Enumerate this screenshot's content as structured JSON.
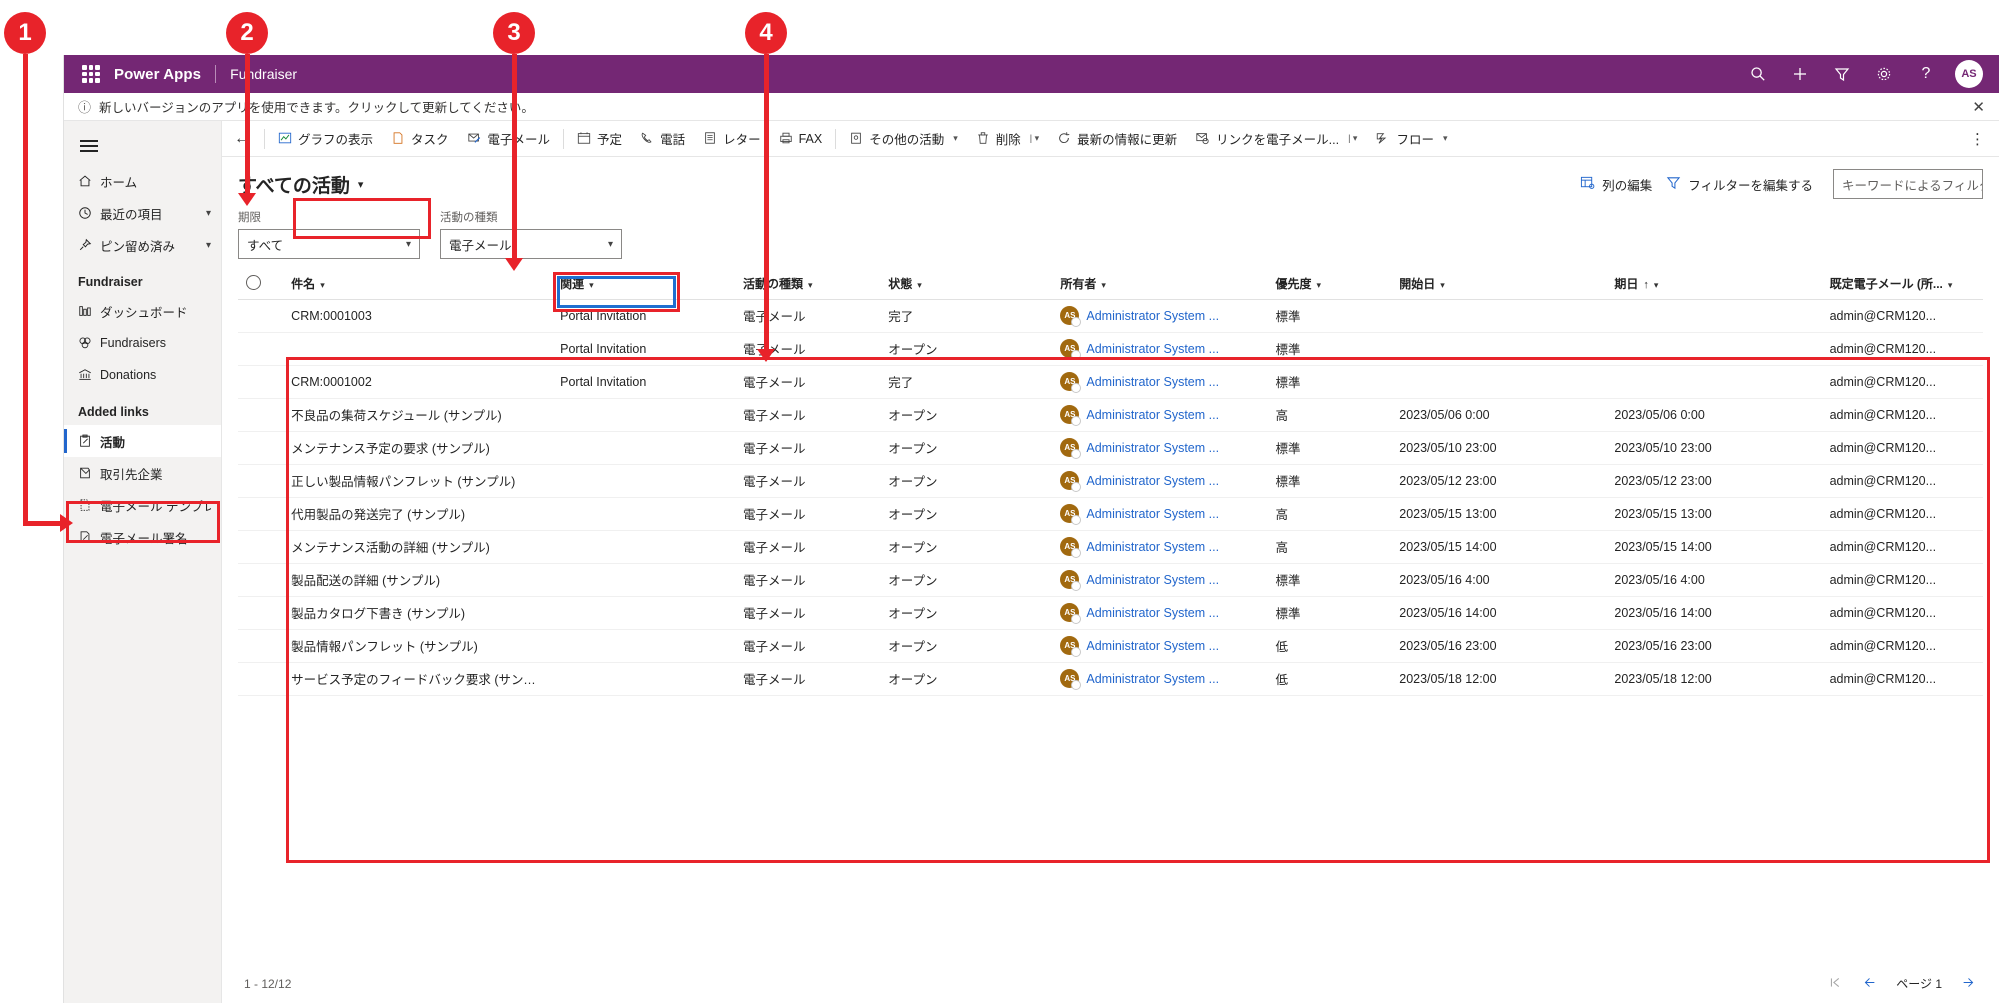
{
  "topbar": {
    "waffle_icon": "waffle-icon",
    "brand": "Power Apps",
    "app_name": "Fundraiser",
    "icons": [
      {
        "name": "search-icon",
        "glyph": "⌕"
      },
      {
        "name": "add-icon",
        "glyph": "＋"
      },
      {
        "name": "filter-icon",
        "glyph": "▽"
      },
      {
        "name": "settings-icon",
        "glyph": "⚙"
      },
      {
        "name": "help-icon",
        "glyph": "?"
      }
    ],
    "avatar_initials": "AS"
  },
  "notice": {
    "icon": "info-icon",
    "text": "新しいバージョンのアプリを使用できます。クリックして更新してください。",
    "close_label": "✕"
  },
  "sidebar": {
    "hamburger_label": "サイト マップの展開/折りたたみ",
    "items": [
      {
        "label": "ホーム",
        "icon": "home-icon",
        "glyph": "⌂",
        "chevron": false,
        "selected": false
      },
      {
        "label": "最近の項目",
        "icon": "clock-icon",
        "glyph": "◴",
        "chevron": true,
        "selected": false
      },
      {
        "label": "ピン留め済み",
        "icon": "pin-icon",
        "glyph": "☆",
        "chevron": true,
        "selected": false
      }
    ],
    "group1_label": "Fundraiser",
    "group1_items": [
      {
        "label": "ダッシュボード",
        "icon": "dashboard-icon",
        "glyph": "▓",
        "selected": false
      },
      {
        "label": "Fundraisers",
        "icon": "fundraisers-icon",
        "glyph": "⍟",
        "selected": false
      },
      {
        "label": "Donations",
        "icon": "donations-icon",
        "glyph": "⛭",
        "selected": false
      }
    ],
    "group2_label": "Added links",
    "group2_items": [
      {
        "label": "活動",
        "icon": "activity-icon",
        "glyph": "✎",
        "selected": true
      },
      {
        "label": "取引先企業",
        "icon": "account-icon",
        "glyph": "⬒",
        "selected": false
      },
      {
        "label": "電子メール テンプレ...",
        "icon": "email-template-icon",
        "glyph": "⬚",
        "selected": false
      },
      {
        "label": "電子メール署名",
        "icon": "email-signature-icon",
        "glyph": "✏",
        "selected": false
      }
    ]
  },
  "commandbar": {
    "back_label": "←",
    "items": [
      {
        "label": "グラフの表示",
        "icon": "chart-icon",
        "glyph": "◰",
        "chevron": false,
        "divider_before": false
      },
      {
        "label": "タスク",
        "icon": "task-icon",
        "glyph": "⬚",
        "chevron": false,
        "divider_before": false
      },
      {
        "label": "電子メール",
        "icon": "email-icon",
        "glyph": "✉",
        "chevron": false,
        "divider_before": false
      },
      {
        "label": "予定",
        "icon": "appointment-icon",
        "glyph": "▦",
        "chevron": false,
        "divider_before": true
      },
      {
        "label": "電話",
        "icon": "phone-icon",
        "glyph": "✆",
        "chevron": false,
        "divider_before": false
      },
      {
        "label": "レター",
        "icon": "letter-icon",
        "glyph": "☰",
        "chevron": false,
        "divider_before": false
      },
      {
        "label": "FAX",
        "icon": "fax-icon",
        "glyph": "⎙",
        "chevron": false,
        "divider_before": false
      },
      {
        "label": "その他の活動",
        "icon": "more-activity-icon",
        "glyph": "☷",
        "chevron": true,
        "divider_before": true
      },
      {
        "label": "削除",
        "icon": "delete-icon",
        "glyph": "Ὕ1",
        "chevron": true,
        "divider_before": false
      },
      {
        "label": "最新の情報に更新",
        "icon": "refresh-icon",
        "glyph": "↻",
        "chevron": false,
        "divider_before": false
      },
      {
        "label": "リンクを電子メール...",
        "icon": "email-link-icon",
        "glyph": "✉",
        "chevron": true,
        "divider_before": false
      },
      {
        "label": "フロー",
        "icon": "flow-icon",
        "glyph": "➤",
        "chevron": true,
        "divider_before": false
      }
    ],
    "overflow_label": "⋮"
  },
  "view": {
    "selected_view": "すべての活動",
    "chevron": "⌄",
    "actions": [
      {
        "label": "列の編集",
        "icon": "edit-columns-icon",
        "glyph": "▤"
      },
      {
        "label": "フィルターを編集する",
        "icon": "edit-filters-icon",
        "glyph": "▽"
      }
    ],
    "search_placeholder": "キーワードによるフィルタ"
  },
  "filters": [
    {
      "label": "期限",
      "value": "すべて",
      "name": "due-filter"
    },
    {
      "label": "活動の種類",
      "value": "電子メール",
      "name": "activity-type-filter"
    }
  ],
  "grid": {
    "columns": [
      {
        "label": "件名",
        "sort": "",
        "chevron": true
      },
      {
        "label": "関連",
        "sort": "",
        "chevron": true
      },
      {
        "label": "活動の種類",
        "sort": "",
        "chevron": true
      },
      {
        "label": "状態",
        "sort": "",
        "chevron": true
      },
      {
        "label": "所有者",
        "sort": "",
        "chevron": true
      },
      {
        "label": "優先度",
        "sort": "",
        "chevron": true
      },
      {
        "label": "開始日",
        "sort": "",
        "chevron": true
      },
      {
        "label": "期日",
        "sort": "↑",
        "chevron": true
      },
      {
        "label": "既定電子メール (所...",
        "sort": "",
        "chevron": true
      }
    ],
    "owner_avatar": "AS",
    "rows": [
      {
        "subject": "CRM:0001003",
        "related": "Portal Invitation",
        "type": "電子メール",
        "status": "完了",
        "owner": "Administrator System ...",
        "priority": "標準",
        "start": "",
        "due": "",
        "email": "admin@CRM120..."
      },
      {
        "subject": "",
        "related": "Portal Invitation",
        "type": "電子メール",
        "status": "オープン",
        "owner": "Administrator System ...",
        "priority": "標準",
        "start": "",
        "due": "",
        "email": "admin@CRM120..."
      },
      {
        "subject": "CRM:0001002",
        "related": "Portal Invitation",
        "type": "電子メール",
        "status": "完了",
        "owner": "Administrator System ...",
        "priority": "標準",
        "start": "",
        "due": "",
        "email": "admin@CRM120..."
      },
      {
        "subject": "不良品の集荷スケジュール (サンプル)",
        "related": "",
        "type": "電子メール",
        "status": "オープン",
        "owner": "Administrator System ...",
        "priority": "高",
        "start": "2023/05/06 0:00",
        "due": "2023/05/06 0:00",
        "email": "admin@CRM120..."
      },
      {
        "subject": "メンテナンス予定の要求 (サンプル)",
        "related": "",
        "type": "電子メール",
        "status": "オープン",
        "owner": "Administrator System ...",
        "priority": "標準",
        "start": "2023/05/10 23:00",
        "due": "2023/05/10 23:00",
        "email": "admin@CRM120..."
      },
      {
        "subject": "正しい製品情報パンフレット (サンプル)",
        "related": "",
        "type": "電子メール",
        "status": "オープン",
        "owner": "Administrator System ...",
        "priority": "標準",
        "start": "2023/05/12 23:00",
        "due": "2023/05/12 23:00",
        "email": "admin@CRM120..."
      },
      {
        "subject": "代用製品の発送完了 (サンプル)",
        "related": "",
        "type": "電子メール",
        "status": "オープン",
        "owner": "Administrator System ...",
        "priority": "高",
        "start": "2023/05/15 13:00",
        "due": "2023/05/15 13:00",
        "email": "admin@CRM120..."
      },
      {
        "subject": "メンテナンス活動の詳細 (サンプル)",
        "related": "",
        "type": "電子メール",
        "status": "オープン",
        "owner": "Administrator System ...",
        "priority": "高",
        "start": "2023/05/15 14:00",
        "due": "2023/05/15 14:00",
        "email": "admin@CRM120..."
      },
      {
        "subject": "製品配送の詳細 (サンプル)",
        "related": "",
        "type": "電子メール",
        "status": "オープン",
        "owner": "Administrator System ...",
        "priority": "標準",
        "start": "2023/05/16 4:00",
        "due": "2023/05/16 4:00",
        "email": "admin@CRM120..."
      },
      {
        "subject": "製品カタログ下書き (サンプル)",
        "related": "",
        "type": "電子メール",
        "status": "オープン",
        "owner": "Administrator System ...",
        "priority": "標準",
        "start": "2023/05/16 14:00",
        "due": "2023/05/16 14:00",
        "email": "admin@CRM120..."
      },
      {
        "subject": "製品情報パンフレット (サンプル)",
        "related": "",
        "type": "電子メール",
        "status": "オープン",
        "owner": "Administrator System ...",
        "priority": "低",
        "start": "2023/05/16 23:00",
        "due": "2023/05/16 23:00",
        "email": "admin@CRM120..."
      },
      {
        "subject": "サービス予定のフィードバック要求 (サンプル)",
        "related": "",
        "type": "電子メール",
        "status": "オープン",
        "owner": "Administrator System ...",
        "priority": "低",
        "start": "2023/05/18 12:00",
        "due": "2023/05/18 12:00",
        "email": "admin@CRM120..."
      }
    ]
  },
  "footer": {
    "record_count": "1 - 12/12",
    "first_page_label": "⏮",
    "prev_page_label": "←",
    "page_label": "ページ 1",
    "next_page_label": "→"
  },
  "annotations": [
    {
      "number": "1",
      "target": "sidebar-item-activity"
    },
    {
      "number": "2",
      "target": "view-selector"
    },
    {
      "number": "3",
      "target": "activity-type-filter"
    },
    {
      "number": "4",
      "target": "grid-results"
    }
  ],
  "colors": {
    "brand_purple": "#742774",
    "link_blue": "#2266cc",
    "annotation_red": "#e8232a",
    "annotation_blue": "#1f6fd0",
    "avatar_gold": "#a1690f"
  }
}
